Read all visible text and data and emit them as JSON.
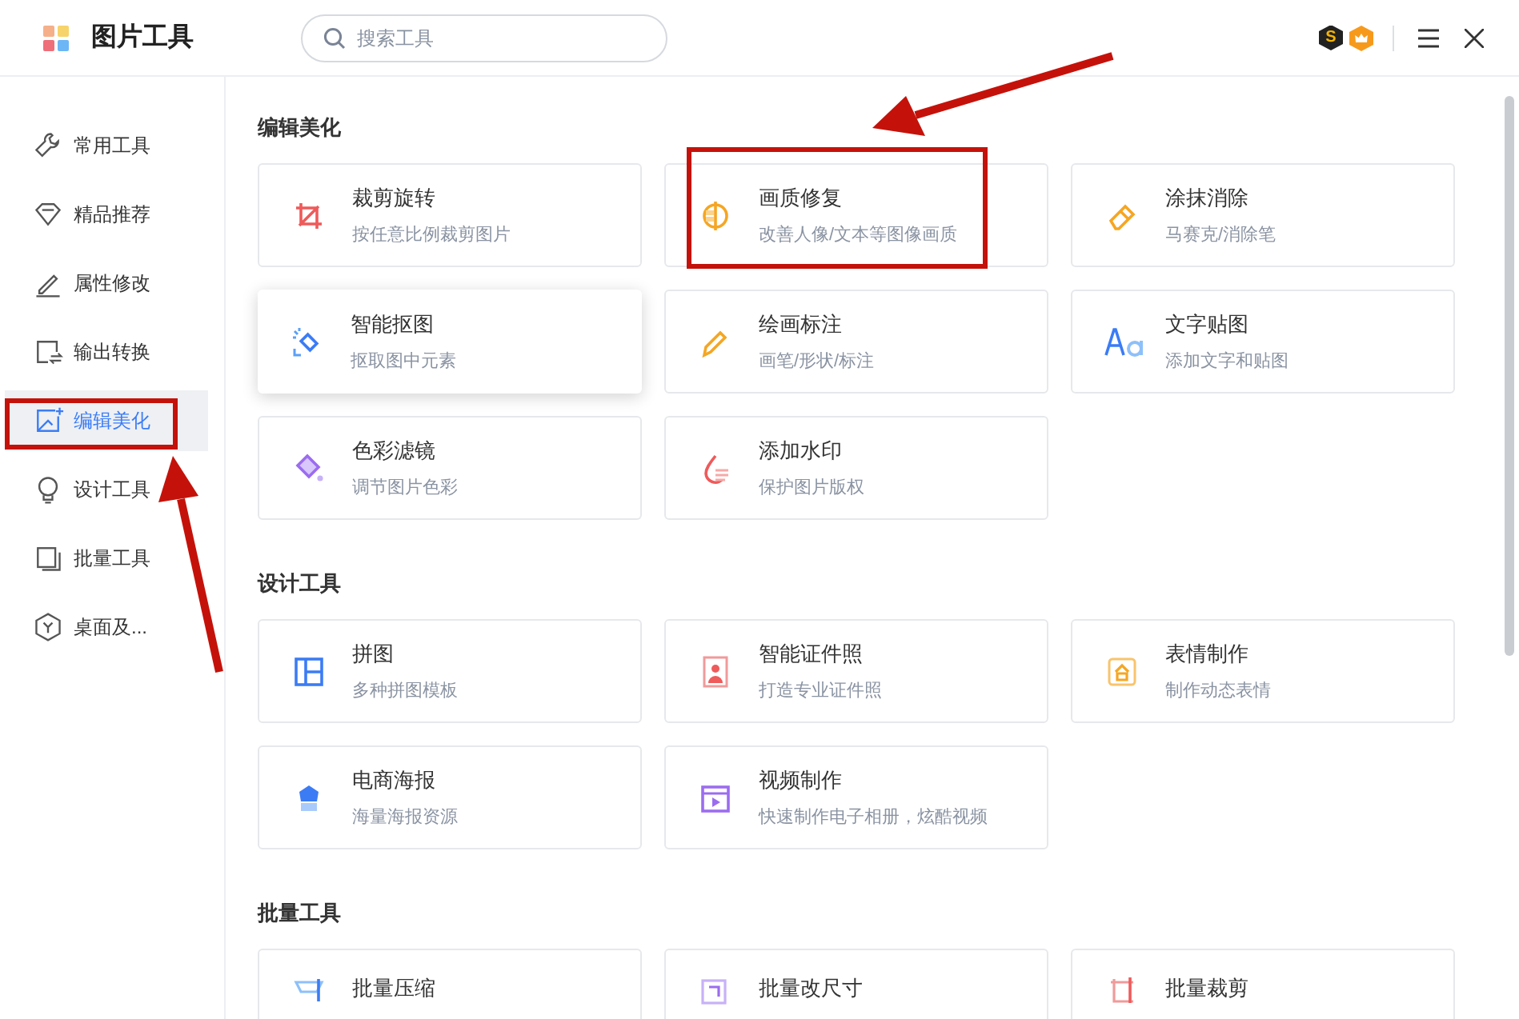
{
  "app": {
    "title": "图片工具"
  },
  "search": {
    "placeholder": "搜索工具"
  },
  "toolbar": {
    "coin_badge": "S"
  },
  "sidebar": {
    "items": [
      {
        "label": "常用工具",
        "selected": false,
        "annotated": false
      },
      {
        "label": "精品推荐",
        "selected": false,
        "annotated": false
      },
      {
        "label": "属性修改",
        "selected": false,
        "annotated": false
      },
      {
        "label": "输出转换",
        "selected": false,
        "annotated": false
      },
      {
        "label": "编辑美化",
        "selected": true,
        "annotated": true
      },
      {
        "label": "设计工具",
        "selected": false,
        "annotated": false
      },
      {
        "label": "批量工具",
        "selected": false,
        "annotated": false
      },
      {
        "label": "桌面及...",
        "selected": false,
        "annotated": false
      }
    ]
  },
  "sections": [
    {
      "title": "编辑美化",
      "cards": [
        {
          "title": "裁剪旋转",
          "subtitle": "按任意比例裁剪图片",
          "hovered": false,
          "annotated": false
        },
        {
          "title": "画质修复",
          "subtitle": "改善人像/文本等图像画质",
          "hovered": false,
          "annotated": true
        },
        {
          "title": "涂抹消除",
          "subtitle": "马赛克/消除笔",
          "hovered": false,
          "annotated": false
        },
        {
          "title": "智能抠图",
          "subtitle": "抠取图中元素",
          "hovered": true,
          "annotated": false
        },
        {
          "title": "绘画标注",
          "subtitle": "画笔/形状/标注",
          "hovered": false,
          "annotated": false
        },
        {
          "title": "文字贴图",
          "subtitle": "添加文字和贴图",
          "hovered": false,
          "annotated": false
        },
        {
          "title": "色彩滤镜",
          "subtitle": "调节图片色彩",
          "hovered": false,
          "annotated": false
        },
        {
          "title": "添加水印",
          "subtitle": "保护图片版权",
          "hovered": false,
          "annotated": false
        }
      ]
    },
    {
      "title": "设计工具",
      "cards": [
        {
          "title": "拼图",
          "subtitle": "多种拼图模板",
          "hovered": false,
          "annotated": false
        },
        {
          "title": "智能证件照",
          "subtitle": "打造专业证件照",
          "hovered": false,
          "annotated": false
        },
        {
          "title": "表情制作",
          "subtitle": "制作动态表情",
          "hovered": false,
          "annotated": false
        },
        {
          "title": "电商海报",
          "subtitle": "海量海报资源",
          "hovered": false,
          "annotated": false
        },
        {
          "title": "视频制作",
          "subtitle": "快速制作电子相册，炫酷视频",
          "hovered": false,
          "annotated": false
        }
      ]
    },
    {
      "title": "批量工具",
      "cards": [
        {
          "title": "批量压缩",
          "hovered": false,
          "annotated": false
        },
        {
          "title": "批量改尺寸",
          "hovered": false,
          "annotated": false
        },
        {
          "title": "批量裁剪",
          "hovered": false,
          "annotated": false
        }
      ]
    }
  ]
}
